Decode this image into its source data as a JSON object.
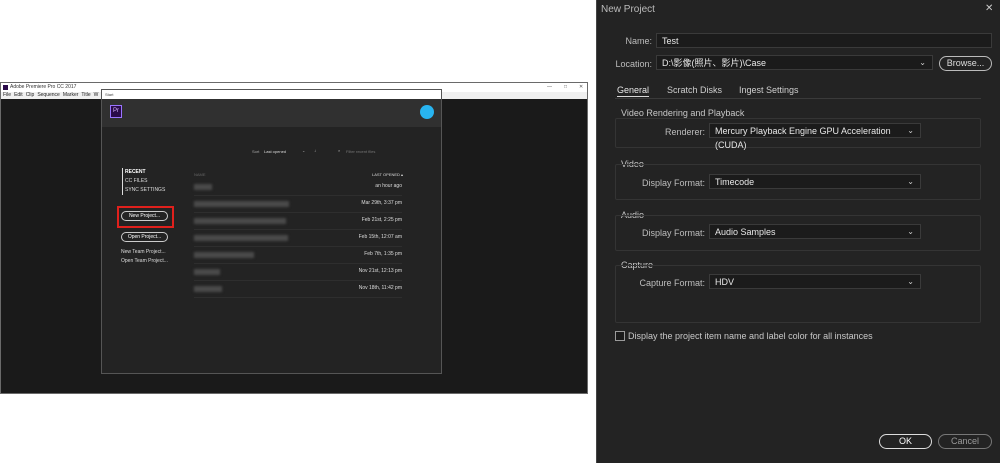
{
  "premiere": {
    "title": "Adobe Premiere Pro CC 2017",
    "menu": [
      "File",
      "Edit",
      "Clip",
      "Sequence",
      "Marker",
      "Title",
      "W"
    ],
    "window_controls": [
      "—",
      "□",
      "✕"
    ],
    "start": {
      "title": "Start",
      "logo": "Pr",
      "sort_label": "Sort",
      "sort_value": "Last opened",
      "filter_placeholder": "Filter recent files",
      "sidebar": [
        "RECENT",
        "CC FILES",
        "SYNC SETTINGS"
      ],
      "new_project": "New Project...",
      "open_project": "Open Project...",
      "new_team_project": "New Team Project...",
      "open_team_project": "Open Team Project...",
      "col_name": "NAME",
      "col_last_opened": "LAST OPENED ▴",
      "recent_dates": [
        "an hour ago",
        "Mar 29th, 3:37 pm",
        "Feb 21st, 2:25 pm",
        "Feb 15th, 12:07 am",
        "Feb 7th, 1:35 pm",
        "Nov 21st, 12:13 pm",
        "Nov 18th, 11:42 pm"
      ]
    }
  },
  "new_project": {
    "title": "New Project",
    "name_label": "Name:",
    "name_value": "Test",
    "location_label": "Location:",
    "location_value": "D:\\影像(照片、影片)\\Case",
    "browse": "Browse...",
    "tabs": [
      "General",
      "Scratch Disks",
      "Ingest Settings"
    ],
    "video_rendering": {
      "title": "Video Rendering and Playback",
      "renderer_label": "Renderer:",
      "renderer_value": "Mercury Playback Engine GPU Acceleration (CUDA)"
    },
    "video": {
      "title": "Video",
      "label": "Display Format:",
      "value": "Timecode"
    },
    "audio": {
      "title": "Audio",
      "label": "Display Format:",
      "value": "Audio Samples"
    },
    "capture": {
      "title": "Capture",
      "label": "Capture Format:",
      "value": "HDV"
    },
    "checkbox_label": "Display the project item name and label color for all instances",
    "ok": "OK",
    "cancel": "Cancel"
  },
  "colors": {
    "accent_red": "#e0201c",
    "cc_blue": "#28b4f0",
    "pr_purple": "#2a0a4a"
  }
}
